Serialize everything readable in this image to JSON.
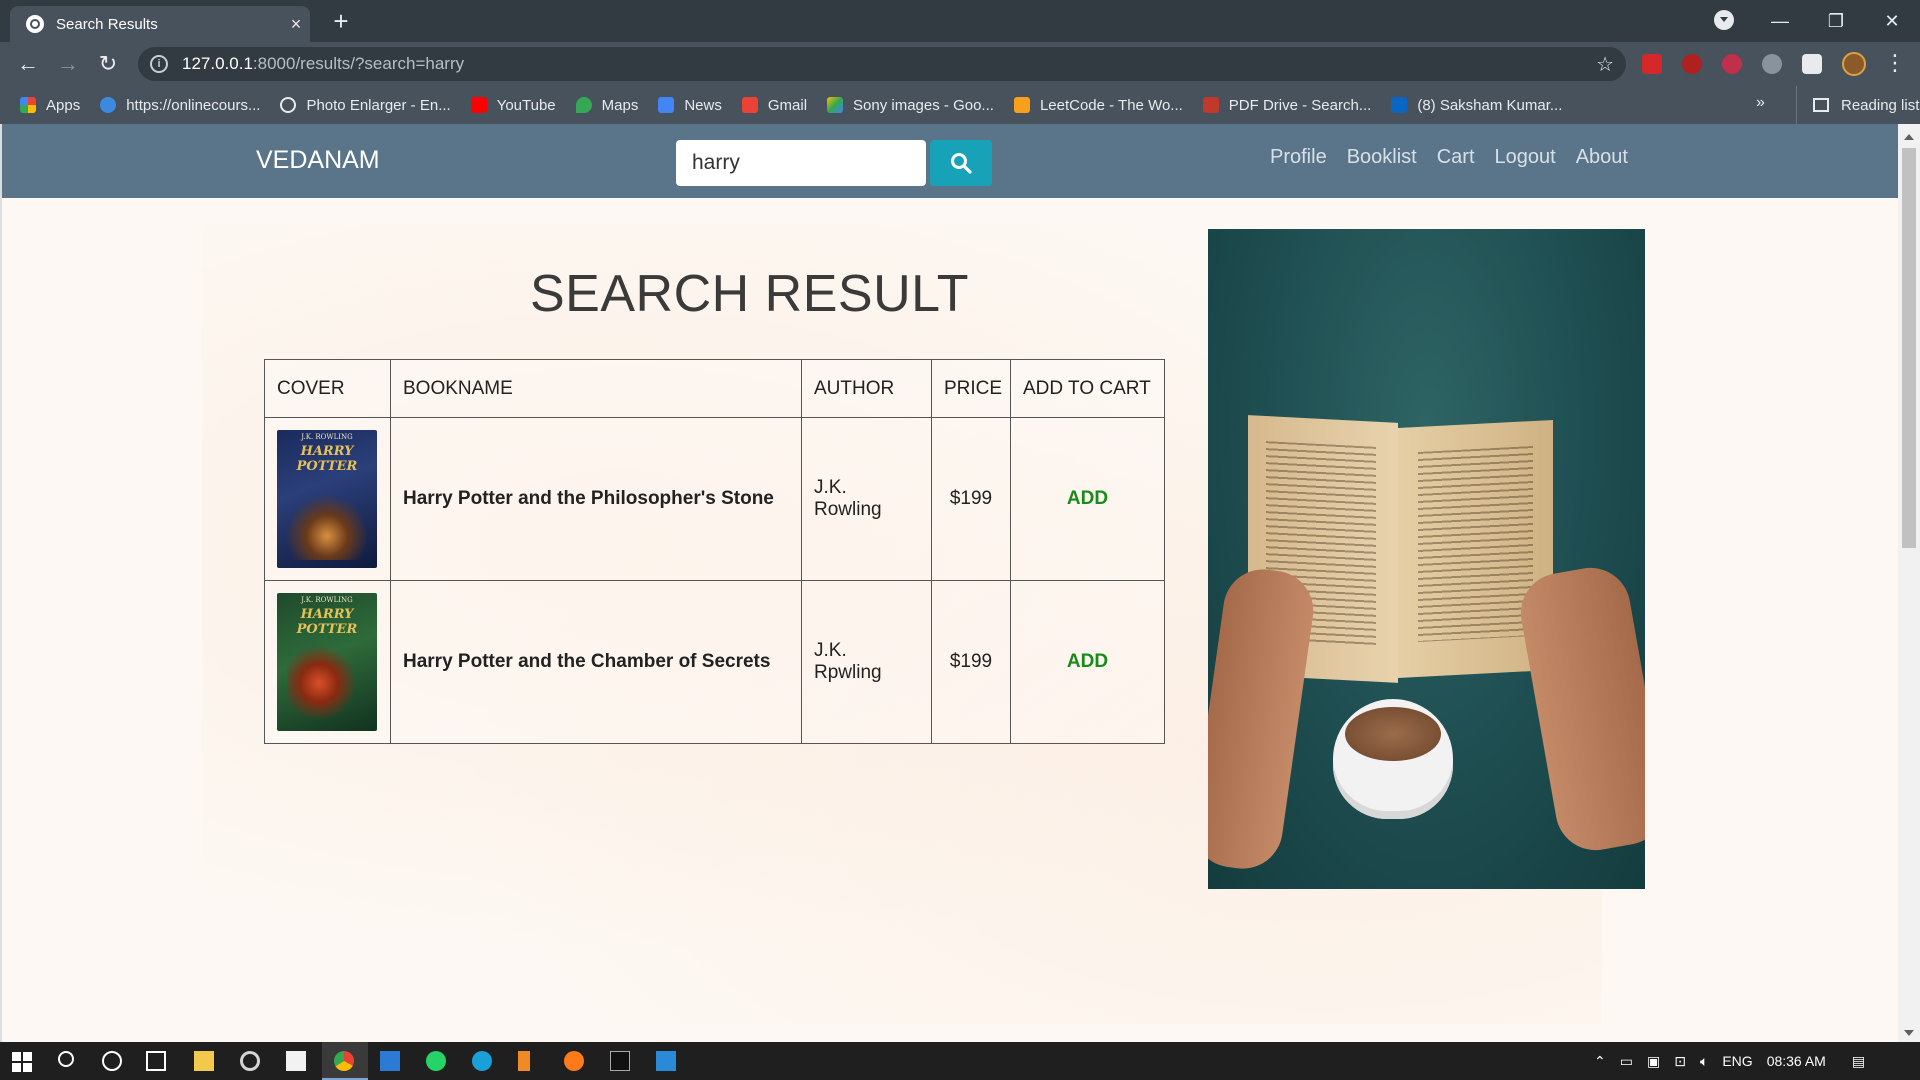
{
  "browser": {
    "tab_title": "Search Results",
    "tab_close": "×",
    "new_tab": "+",
    "url_host": "127.0.0.1",
    "url_path": ":8000/results/?search=harry",
    "bookmarks": [
      {
        "label": "Apps",
        "color": "#e0603a"
      },
      {
        "label": "https://onlinecours...",
        "color": "#3b8ae0"
      },
      {
        "label": "Photo Enlarger - En...",
        "color": "#e8eaed"
      },
      {
        "label": "YouTube",
        "color": "#ff0000"
      },
      {
        "label": "Maps",
        "color": "#34a853"
      },
      {
        "label": "News",
        "color": "#4285f4"
      },
      {
        "label": "Gmail",
        "color": "#ea4335"
      },
      {
        "label": "Sony images - Goo...",
        "color": "#fbbc05"
      },
      {
        "label": "LeetCode - The Wo...",
        "color": "#f89f1b"
      },
      {
        "label": "PDF Drive - Search...",
        "color": "#c0392b"
      },
      {
        "label": "(8) Saksham Kumar...",
        "color": "#0a66c2"
      }
    ],
    "bookmarks_more": "»",
    "reading_list": "Reading list"
  },
  "site": {
    "brand": "VEDANAM",
    "search_value": "harry",
    "nav": [
      "Profile",
      "Booklist",
      "Cart",
      "Logout",
      "About"
    ]
  },
  "main": {
    "title": "SEARCH RESULT",
    "columns": [
      "COVER",
      "BOOKNAME",
      "AUTHOR",
      "PRICE",
      "ADD TO CART"
    ],
    "rows": [
      {
        "cover_author": "J.K. ROWLING",
        "cover_title": "HARRY POTTER",
        "bookname": "Harry Potter and the Philosopher's Stone",
        "author": "J.K. Rowling",
        "price": "$199",
        "action": "ADD"
      },
      {
        "cover_author": "J.K. ROWLING",
        "cover_title": "HARRY POTTER",
        "bookname": "Harry Potter and the Chamber of Secrets",
        "author": "J.K. Rpwling",
        "price": "$199",
        "action": "ADD"
      }
    ]
  },
  "taskbar": {
    "lang": "ENG",
    "time": "08:36 AM"
  },
  "colors": {
    "navbar": "#5a7589",
    "search_button": "#17a2b8",
    "add_link": "#1a8a1a"
  }
}
